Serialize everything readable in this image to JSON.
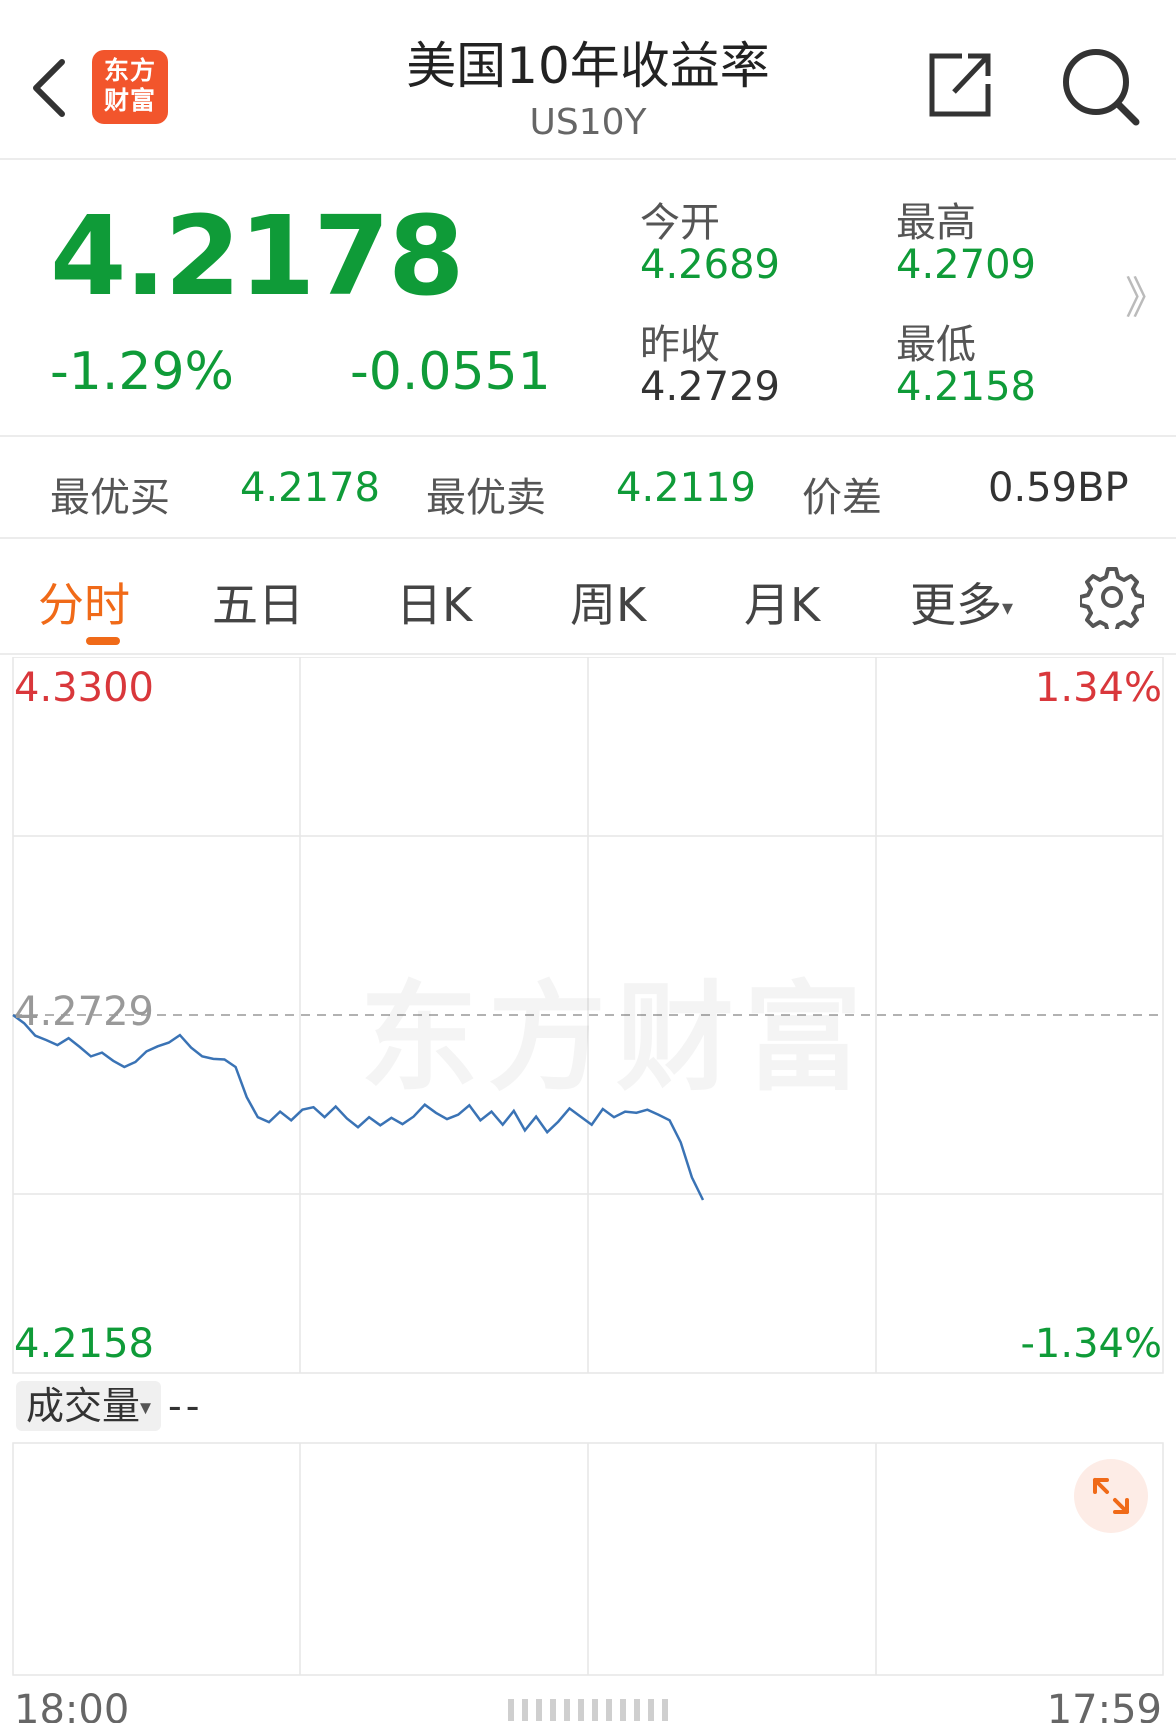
{
  "header": {
    "title": "美国10年收益率",
    "subtitle": "US10Y",
    "logo_text_line1": "东方",
    "logo_text_line2": "财富",
    "back_icon": "chevron-left-icon",
    "share_icon": "share-icon",
    "search_icon": "search-icon"
  },
  "quote": {
    "price": "4.2178",
    "change_pct": "-1.29%",
    "change_abs": "-0.0551",
    "open_label": "今开",
    "open_value": "4.2689",
    "high_label": "最高",
    "high_value": "4.2709",
    "prev_close_label": "昨收",
    "prev_close_value": "4.2729",
    "low_label": "最低",
    "low_value": "4.2158",
    "more_arrow": "》",
    "colors": {
      "down": "#0f9b38",
      "up": "#d9373b",
      "neutral": "#333333"
    }
  },
  "bidask": {
    "best_bid_label": "最优买",
    "best_bid_value": "4.2178",
    "best_ask_label": "最优卖",
    "best_ask_value": "4.2119",
    "spread_label": "价差",
    "spread_value": "0.59BP"
  },
  "tabs": {
    "items": [
      "分时",
      "五日",
      "日K",
      "周K",
      "月K",
      "更多"
    ],
    "active": "分时",
    "more_caret": "▾",
    "settings_icon": "gear-icon",
    "accent": "#f06a18"
  },
  "chart": {
    "y_top_label": "4.3300",
    "y_mid_label": "4.2729",
    "y_bottom_label": "4.2158",
    "pct_top_label": "1.34%",
    "pct_bottom_label": "-1.34%",
    "watermark": "东方财富",
    "volume_selector": "成交量",
    "volume_value": "--",
    "x_start_label": "18:00",
    "x_end_label": "17:59",
    "expand_icon": "expand-arrows-icon",
    "line_color": "#3a73b5"
  },
  "chart_data": {
    "type": "line",
    "title": "",
    "xlabel": "",
    "ylabel": "",
    "ylim": [
      4.2158,
      4.33
    ],
    "reference_value": 4.2729,
    "x_range_labels": [
      "18:00",
      "17:59"
    ],
    "fraction_of_session_shown": 0.6,
    "series": [
      {
        "values": [
          4.2729,
          4.2716,
          4.2696,
          4.2689,
          4.2681,
          4.2692,
          4.2678,
          4.2663,
          4.2669,
          4.2656,
          4.2646,
          4.2654,
          4.2671,
          4.2679,
          4.2685,
          4.2697,
          4.2677,
          4.2663,
          4.2659,
          4.2658,
          4.2646,
          4.2598,
          4.2566,
          4.2558,
          4.2575,
          4.2561,
          4.2578,
          4.2582,
          4.2566,
          4.2583,
          4.2564,
          4.255,
          4.2566,
          4.2553,
          4.2565,
          4.2555,
          4.2567,
          4.2586,
          4.2573,
          4.2563,
          4.257,
          4.2585,
          4.2561,
          4.2575,
          4.2554,
          4.2576,
          4.2545,
          4.2567,
          4.2542,
          4.2559,
          4.258,
          4.2567,
          4.2554,
          4.2579,
          4.2566,
          4.2575,
          4.2573,
          4.2578,
          4.257,
          4.2561,
          4.2526,
          4.247,
          4.2434
        ]
      }
    ]
  }
}
